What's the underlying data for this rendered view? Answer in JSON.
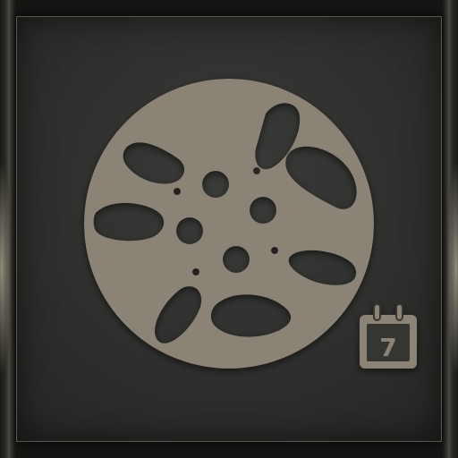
{
  "app": {
    "name": "film-reel-calendar-icon",
    "accent_color": "#8a8376",
    "background_color": "#2f2f2d"
  },
  "icons": {
    "main": "film-reel-icon",
    "badge": "calendar-icon"
  },
  "calendar_badge": {
    "day": "7"
  }
}
